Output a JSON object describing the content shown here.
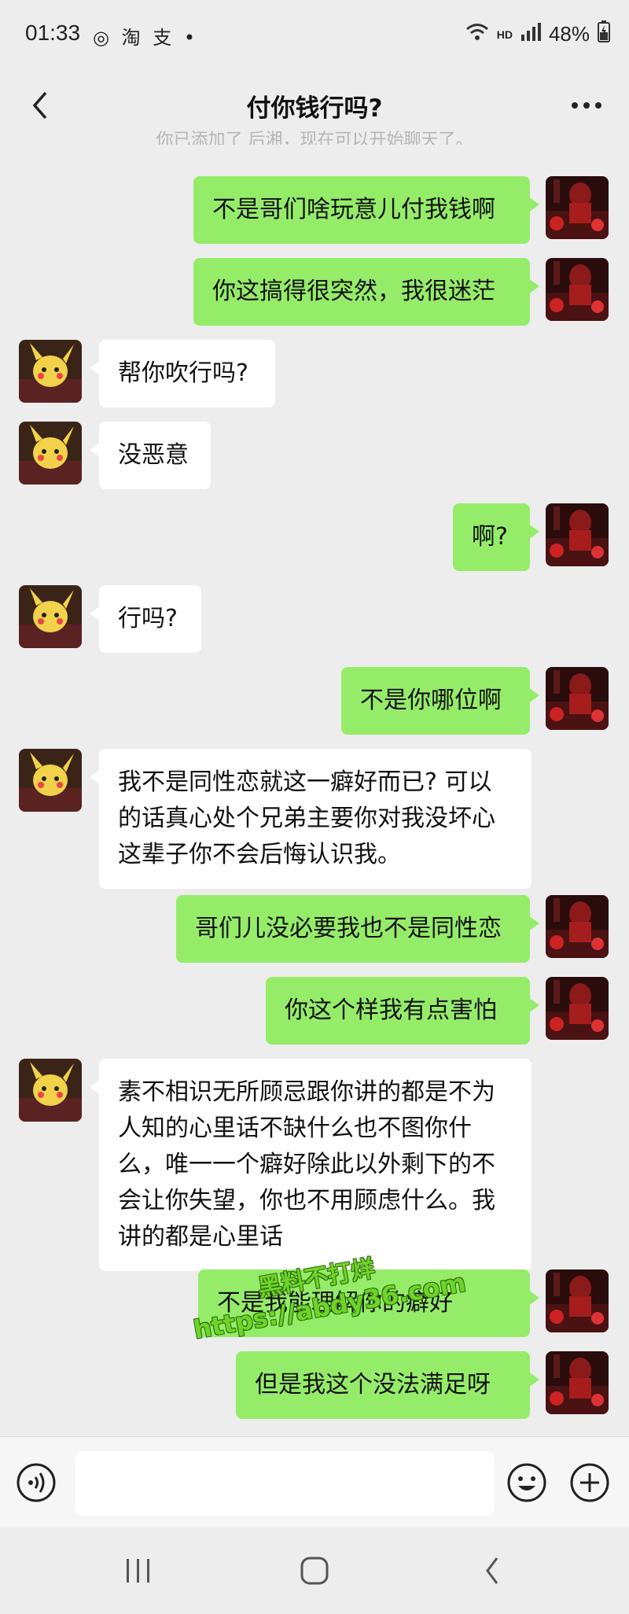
{
  "status_bar": {
    "time": "01:33",
    "app_icons": "◎ 淘 支 •",
    "hd": "HD",
    "battery": "48%"
  },
  "header": {
    "title": "付你钱行吗?"
  },
  "system_note": "你已添加了 后湘，现在可以开始聊天了。",
  "messages": [
    {
      "from": "me",
      "text": "不是哥们啥玩意儿付我钱啊"
    },
    {
      "from": "me",
      "text": "你这搞得很突然，我很迷茫"
    },
    {
      "from": "them",
      "text": "帮你吹行吗?"
    },
    {
      "from": "them",
      "text": "没恶意"
    },
    {
      "from": "me",
      "text": "啊?"
    },
    {
      "from": "them",
      "text": "行吗?"
    },
    {
      "from": "me",
      "text": "不是你哪位啊"
    },
    {
      "from": "them",
      "text": "我不是同性恋就这一癖好而已? 可以的话真心处个兄弟主要你对我没坏心这辈子你不会后悔认识我。"
    },
    {
      "from": "me",
      "text": "哥们儿没必要我也不是同性恋"
    },
    {
      "from": "me",
      "text": "你这个样我有点害怕"
    },
    {
      "from": "them",
      "text": "素不相识无所顾忌跟你讲的都是不为人知的心里话不缺什么也不图你什么，唯一一个癖好除此以外剩下的不会让你失望，你也不用顾虑什么。我讲的都是心里话"
    },
    {
      "from": "me",
      "text": "不是我能理解你的癖好"
    },
    {
      "from": "me",
      "text": "但是我这个没法满足呀"
    }
  ],
  "watermark": {
    "line1": "黑料不打烊",
    "line2": "https://abdy36.com"
  },
  "colors": {
    "background": "#ededed",
    "my_bubble": "#95ec69",
    "their_bubble": "#ffffff"
  }
}
